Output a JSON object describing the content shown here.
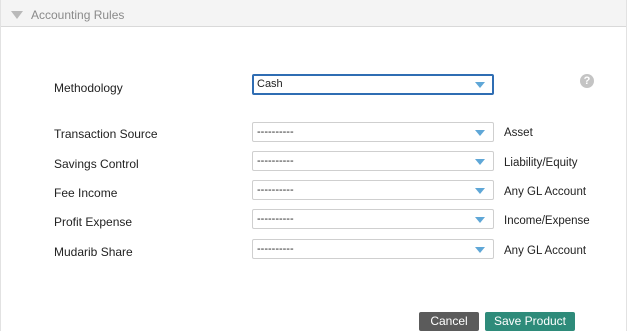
{
  "section": {
    "title": "Accounting Rules"
  },
  "methodology": {
    "label": "Methodology",
    "value": "Cash"
  },
  "help": {
    "glyph": "?"
  },
  "rules": [
    {
      "label": "Transaction Source",
      "value": "----------",
      "account_type": "Asset"
    },
    {
      "label": "Savings Control",
      "value": "----------",
      "account_type": "Liability/Equity"
    },
    {
      "label": "Fee Income",
      "value": "----------",
      "account_type": "Any GL Account"
    },
    {
      "label": "Profit Expense",
      "value": "----------",
      "account_type": "Income/Expense"
    },
    {
      "label": "Mudarib Share",
      "value": "----------",
      "account_type": "Any GL Account"
    }
  ],
  "actions": {
    "cancel_label": "Cancel",
    "save_label": "Save Product"
  },
  "colors": {
    "focus_border": "#2f6db3",
    "dropdown_arrow": "#5fa7d7",
    "cancel_button": "#5b5b5b",
    "save_button": "#2e8b7a"
  }
}
